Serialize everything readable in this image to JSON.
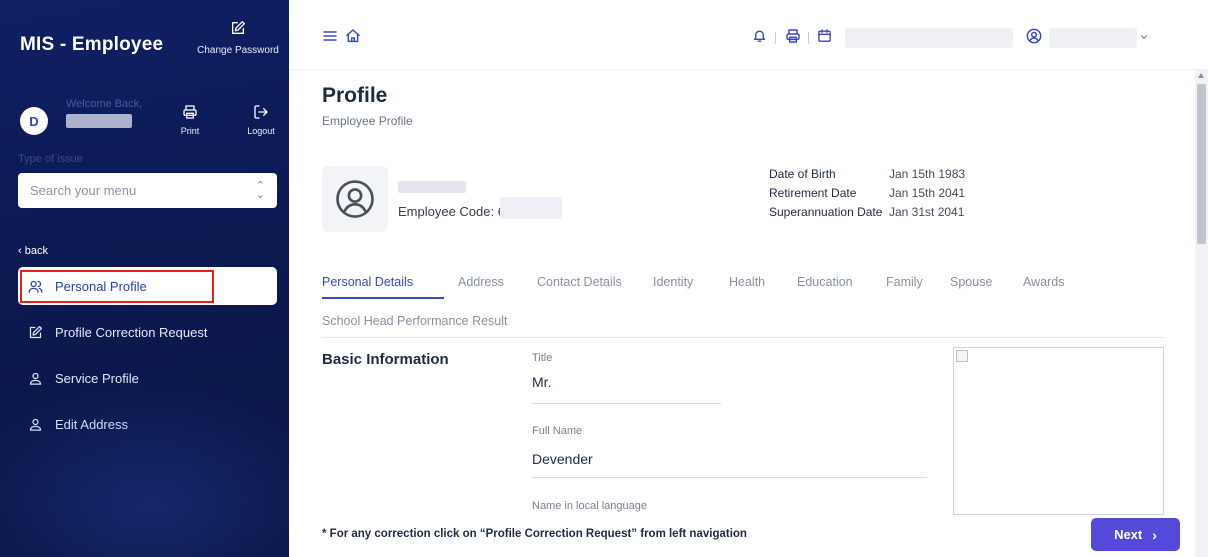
{
  "sidebar": {
    "brand": "MIS - Employee",
    "change_password": "Change Password",
    "avatar_initial": "D",
    "welcome": "Welcome Back,",
    "print": "Print",
    "logout": "Logout",
    "type_label": "Type of issue",
    "search_placeholder": "Search your menu",
    "back": "back",
    "items": [
      {
        "label": "Personal Profile",
        "icon": "users-icon",
        "active": true
      },
      {
        "label": "Profile Correction Request",
        "icon": "edit-icon",
        "active": false
      },
      {
        "label": "Service Profile",
        "icon": "user-icon",
        "active": false
      },
      {
        "label": "Edit Address",
        "icon": "user-icon",
        "active": false
      }
    ]
  },
  "topbar": {
    "icons": [
      "menu-icon",
      "home-icon",
      "bell-icon",
      "print-icon",
      "calendar-icon",
      "user-circle-icon",
      "chevron-down-icon"
    ]
  },
  "main": {
    "title": "Profile",
    "subtitle": "Employee Profile",
    "employee_code_label": "Employee Code: 6",
    "info": [
      {
        "label": "Date of Birth",
        "value": "Jan 15th 1983"
      },
      {
        "label": "Retirement Date",
        "value": "Jan 15th 2041"
      },
      {
        "label": "Superannuation Date",
        "value": "Jan 31st 2041"
      }
    ],
    "tabs": [
      "Personal Details",
      "Address",
      "Contact Details",
      "Identity",
      "Health",
      "Education",
      "Family",
      "Spouse",
      "Awards",
      "School Head Performance Result"
    ],
    "active_tab": "Personal Details",
    "section_title": "Basic Information",
    "fields": [
      {
        "label": "Title",
        "value": "Mr."
      },
      {
        "label": "Full Name",
        "value": "Devender"
      },
      {
        "label": "Name in local language",
        "value": ""
      }
    ],
    "footer_note": "* For any correction click on “Profile Correction Request” from left navigation",
    "next_label": "Next"
  },
  "colors": {
    "sidebar_bg": "#0c1a52",
    "accent": "#3a49c0",
    "next_button": "#5449d8",
    "highlight": "#e3201b"
  }
}
